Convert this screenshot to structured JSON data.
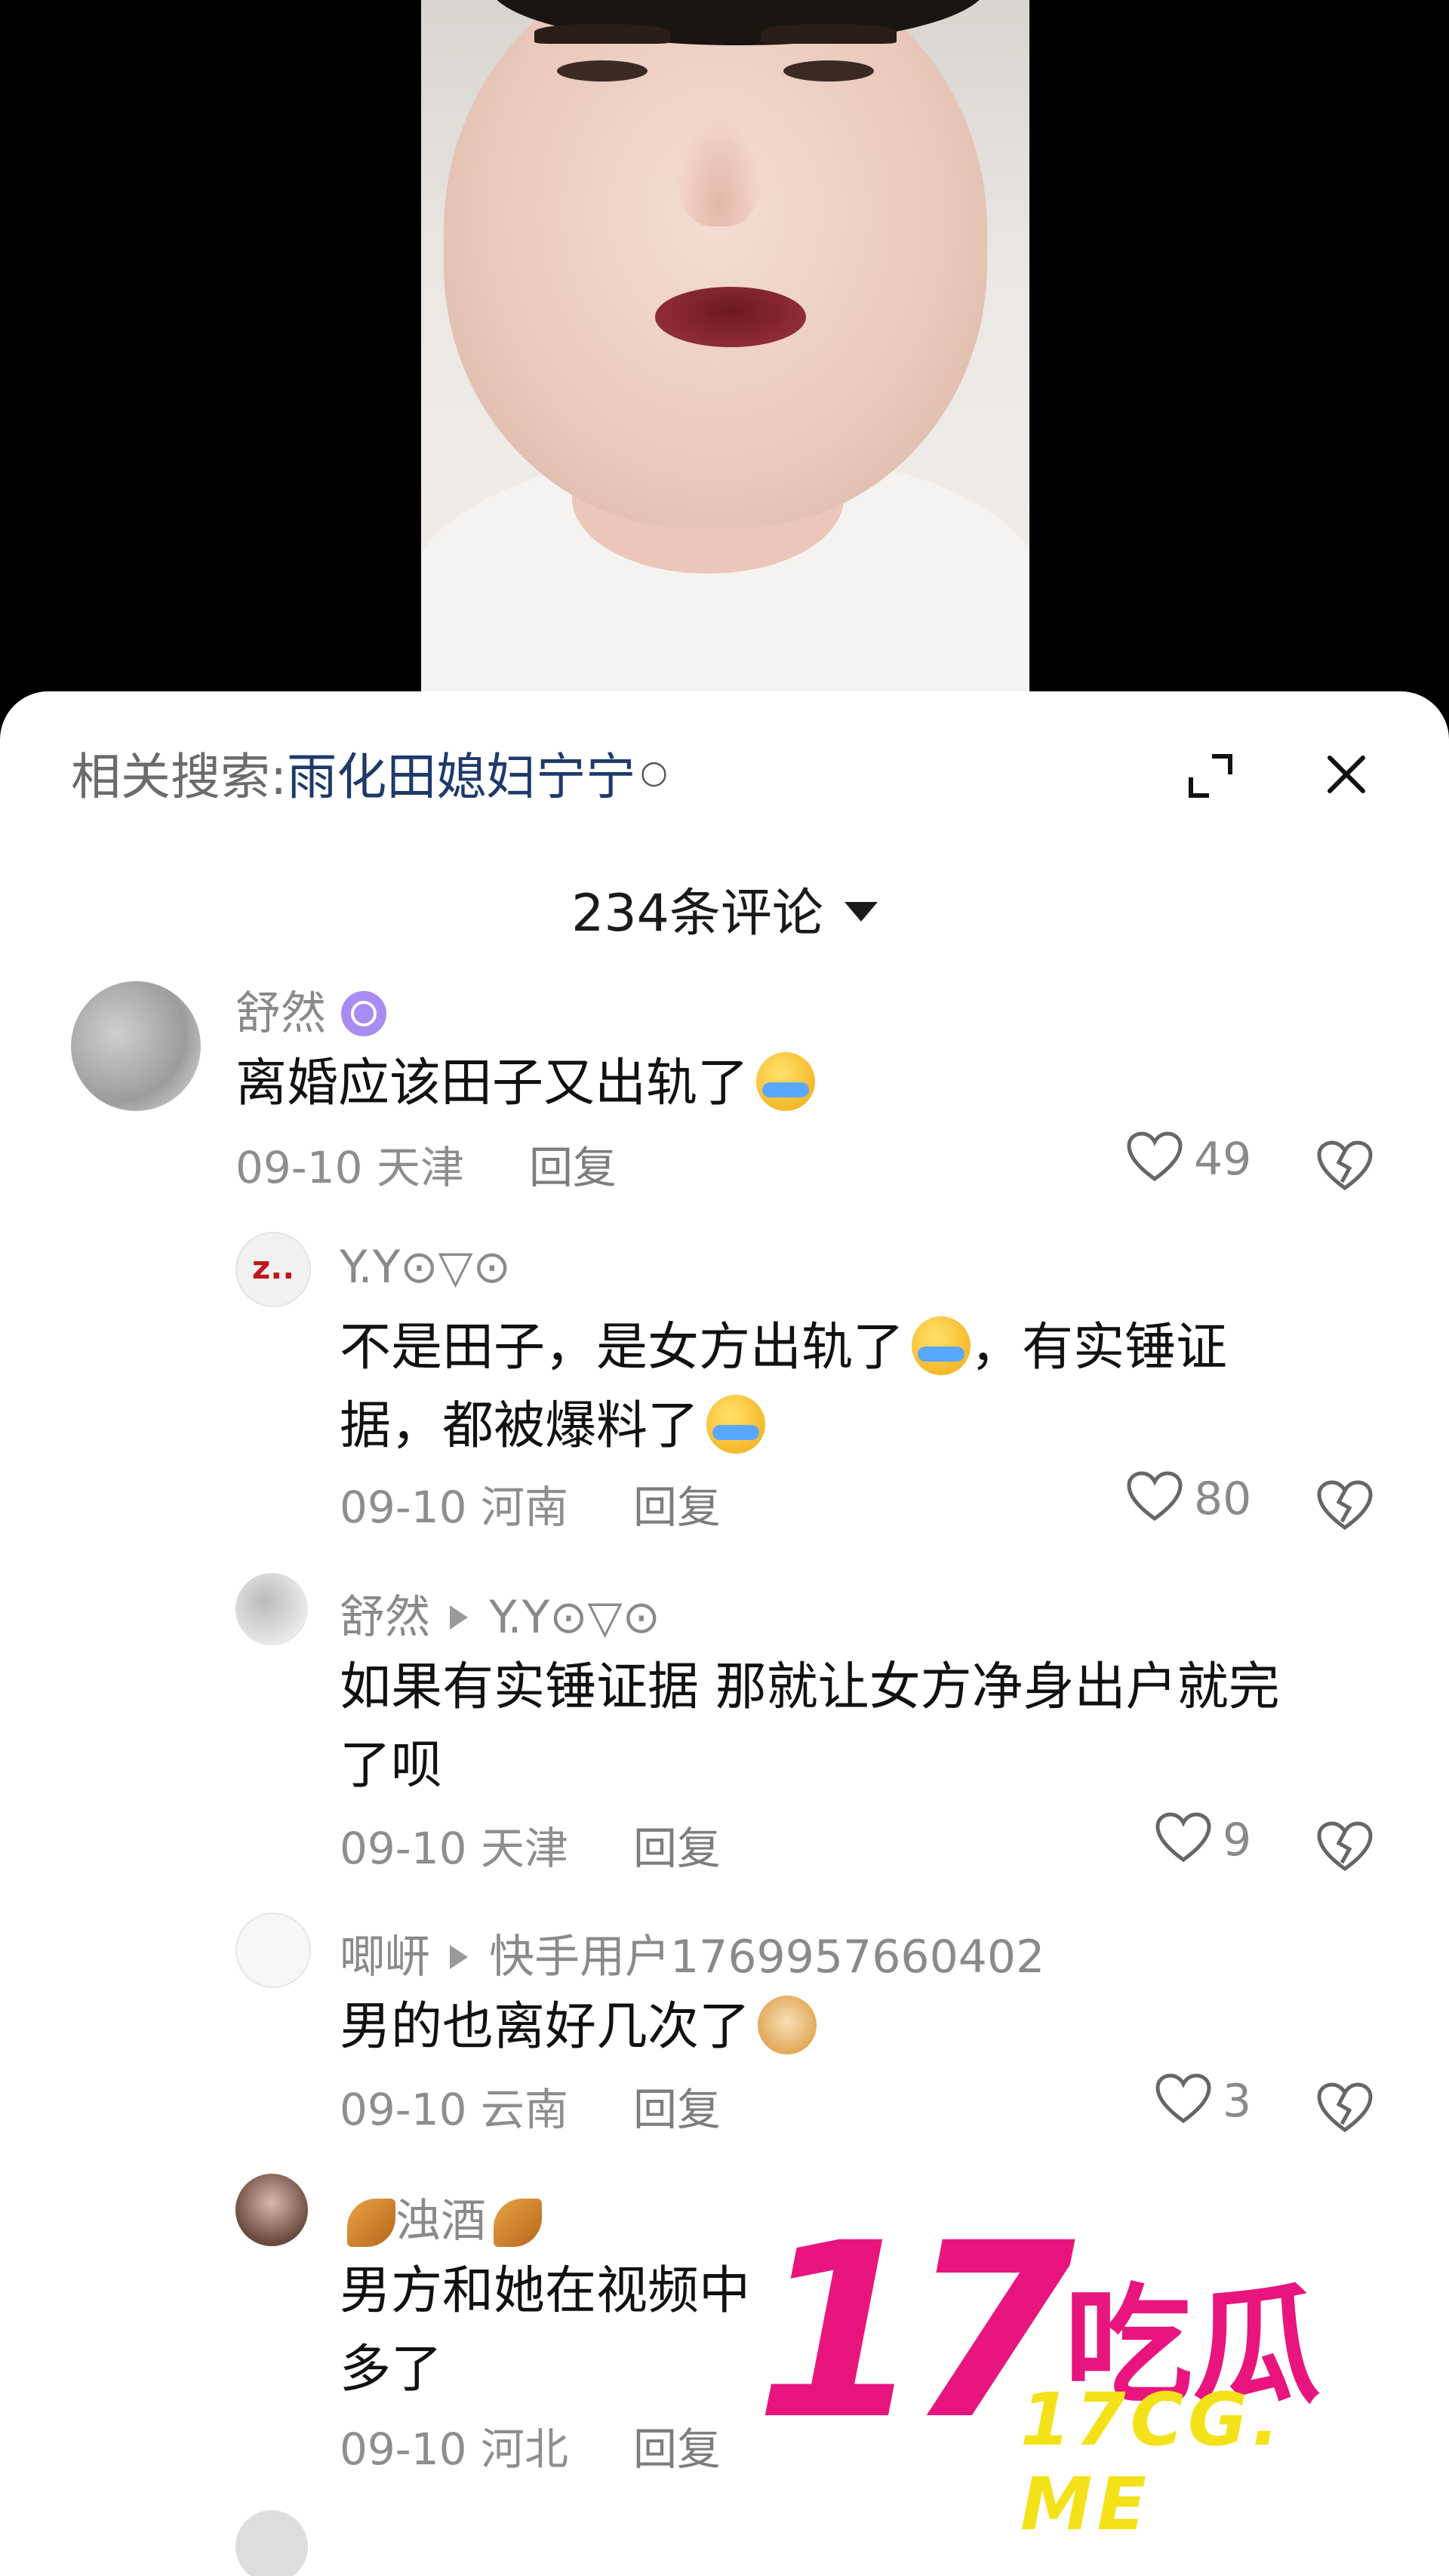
{
  "related_search": {
    "label": "相关搜索:",
    "term": "雨化田媳妇宁宁"
  },
  "comments_header": {
    "count_label": "234条评论"
  },
  "comments": [
    {
      "user": "舒然",
      "text": "离婚应该田子又出轨了",
      "date": "09-10",
      "location": "天津",
      "reply_label": "回复",
      "likes": "49"
    },
    {
      "user": "Y.Y⊙▽⊙",
      "text": "不是田子，是女方出轨了，有实锤证据，都被爆料了",
      "text_line1": "不是田子，是女方出轨了",
      "text_line1b": "，有实锤证",
      "text_line2": "据，都被爆料了",
      "date": "09-10",
      "location": "河南",
      "reply_label": "回复",
      "likes": "80",
      "avatar_text": "z.."
    },
    {
      "user": "舒然",
      "reply_to": "Y.Y⊙▽⊙",
      "text_line1": "如果有实锤证据  那就让女方净身出户就完",
      "text_line2": "了呗",
      "date": "09-10",
      "location": "天津",
      "reply_label": "回复",
      "likes": "9"
    },
    {
      "user": "唧岍",
      "reply_to": "快手用户1769957660402",
      "text": "男的也离好几次了",
      "date": "09-10",
      "location": "云南",
      "reply_label": "回复",
      "likes": "3"
    },
    {
      "user": "浊酒",
      "text_line1": "男方和她在视频中也说了，他们已经离婚",
      "text_line1_visible": "男方和她在视频中",
      "text_line2": "多了",
      "date": "09-10",
      "location": "河北",
      "reply_label": "回复"
    }
  ],
  "watermark": {
    "big": "17",
    "cn": "吃瓜",
    "url": "17CG. ME"
  },
  "icons": {
    "expand": "expand-icon",
    "close": "close-icon",
    "like": "heart-icon",
    "dislike": "broken-heart-icon"
  },
  "colors": {
    "accent_link": "#1e3a6b",
    "badge": "#a88bf3",
    "watermark_pink": "#e8157f",
    "watermark_yellow": "#f3e21a"
  }
}
